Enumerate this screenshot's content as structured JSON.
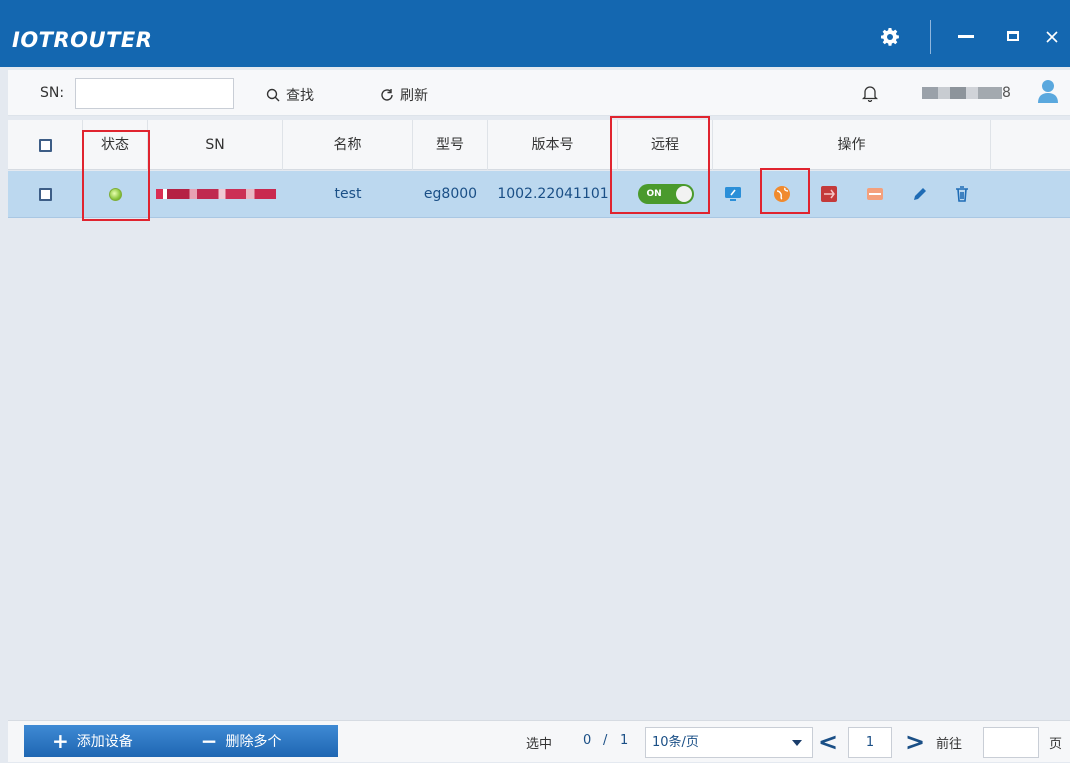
{
  "window": {
    "title": "IOTROUTER",
    "minimize": "−",
    "maximize": "□",
    "close": "✕"
  },
  "toolbar": {
    "sn_label": "SN:",
    "sn_value": "",
    "search_label": "查找",
    "refresh_label": "刷新",
    "user_suffix": "8"
  },
  "table": {
    "headers": [
      "状态",
      "SN",
      "名称",
      "型号",
      "版本号",
      "远程",
      "操作"
    ],
    "rows": [
      {
        "name": "test",
        "model": "eg8000",
        "version": "1002.22041101",
        "remote": "ON",
        "remote_on": true
      }
    ]
  },
  "footer": {
    "add_label": "添加设备",
    "delete_label": "删除多个",
    "selected_label": "选中",
    "selected_count": "0",
    "separator": "/",
    "total": "1",
    "page_size": "10条/页",
    "page_number": "1",
    "goto_label": "前往",
    "page_unit": "页"
  },
  "colors": {
    "titlebar": "#1467b0",
    "row_selected": "#bcd8ef",
    "highlight": "#e0242f"
  }
}
